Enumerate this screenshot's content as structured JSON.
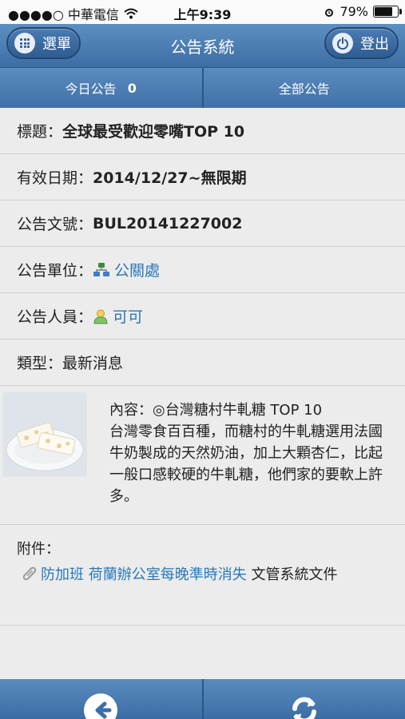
{
  "status_bar": {
    "carrier": "●●●●○ 中華電信",
    "time": "上午9:39",
    "battery": "79%",
    "battery_level": 0.79
  },
  "header": {
    "title": "公告系統",
    "menu_label": "選單",
    "logout_label": "登出"
  },
  "tabs": {
    "today_label": "今日公告",
    "today_count": "0",
    "all_label": "全部公告"
  },
  "detail": {
    "title_label": "標題：",
    "title_value": "全球最受歡迎零嘴TOP 10",
    "date_label": "有效日期：",
    "date_value": "2014/12/27~無限期",
    "number_label": "公告文號：",
    "number_value": "BUL20141227002",
    "unit_label": "公告單位：",
    "unit_value": "公關處",
    "person_label": "公告人員：",
    "person_value": "可可",
    "type_label": "類型：",
    "type_value": "最新消息",
    "content_label": "內容：",
    "content_heading": "◎台灣糖村牛軋糖 TOP 10",
    "content_body": "台灣零食百百種，而糖村的牛軋糖選用法國牛奶製成的天然奶油，加上大顆杏仁，比起一般口感較硬的牛軋糖，他們家的要軟上許多。"
  },
  "attachment": {
    "label": "附件：",
    "link_text": "防加班 荷蘭辦公室每晚準時消失",
    "suffix": " 文管系統文件"
  },
  "colors": {
    "accent": "#3c6ea5",
    "link": "#2a78b8"
  },
  "icons": {
    "menu": "grid-icon",
    "logout": "power-icon",
    "unit": "org-chart-icon",
    "person": "person-icon",
    "attachment": "paperclip-icon",
    "back": "back-arrow-icon",
    "refresh": "refresh-icon"
  }
}
